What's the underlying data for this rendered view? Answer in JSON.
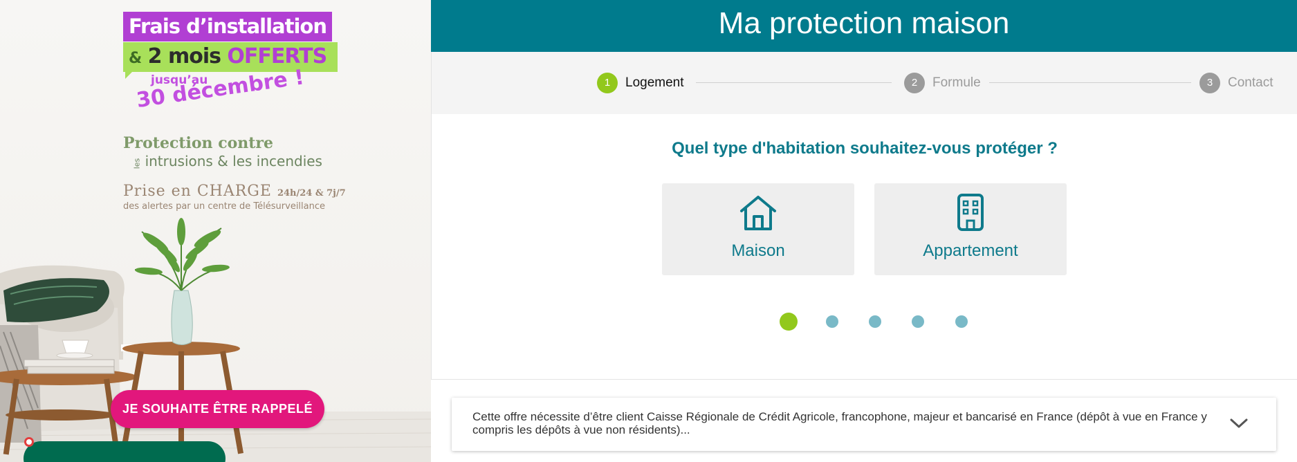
{
  "promo": {
    "headline_1": "Frais d’installation",
    "headline_2_amp": "&",
    "headline_2_main": "2 mois",
    "headline_2_offered": "OFFERTS",
    "until": "jusqu’au",
    "date": "30 décembre !",
    "protection_title": "Protection contre",
    "protection_les": "les",
    "protection_sub": "intrusions & les incendies",
    "charge_title": "Prise en CHARGE",
    "charge_hours": "24h/24 & 7j/7",
    "charge_sub": "des alertes par un centre de Télésurveillance",
    "callback_label": "JE SOUHAITE ÊTRE RAPPELÉ",
    "colors": {
      "headline_bg": "#b13fd3",
      "bubble_bg": "#a8e05a",
      "callback_bg": "#e2177c"
    }
  },
  "header": {
    "title": "Ma protection maison",
    "color": "#007b8d"
  },
  "stepper": {
    "steps": [
      {
        "num": "1",
        "label": "Logement",
        "state": "active"
      },
      {
        "num": "2",
        "label": "Formule",
        "state": "todo"
      },
      {
        "num": "3",
        "label": "Contact",
        "state": "todo"
      }
    ]
  },
  "question": {
    "text": "Quel type d'habitation souhaitez-vous protéger ?",
    "choices": [
      {
        "label": "Maison",
        "icon": "house-icon"
      },
      {
        "label": "Appartement",
        "icon": "building-icon"
      }
    ]
  },
  "pagination": {
    "total": 5,
    "current": 1
  },
  "disclaimer": {
    "text": "Cette offre nécessite d’être client Caisse Régionale de Crédit Agricole, francophone, majeur et bancarisé en France (dépôt à vue en France y compris les dépôts à vue non résidents)...",
    "icon": "chevron-down-icon"
  }
}
